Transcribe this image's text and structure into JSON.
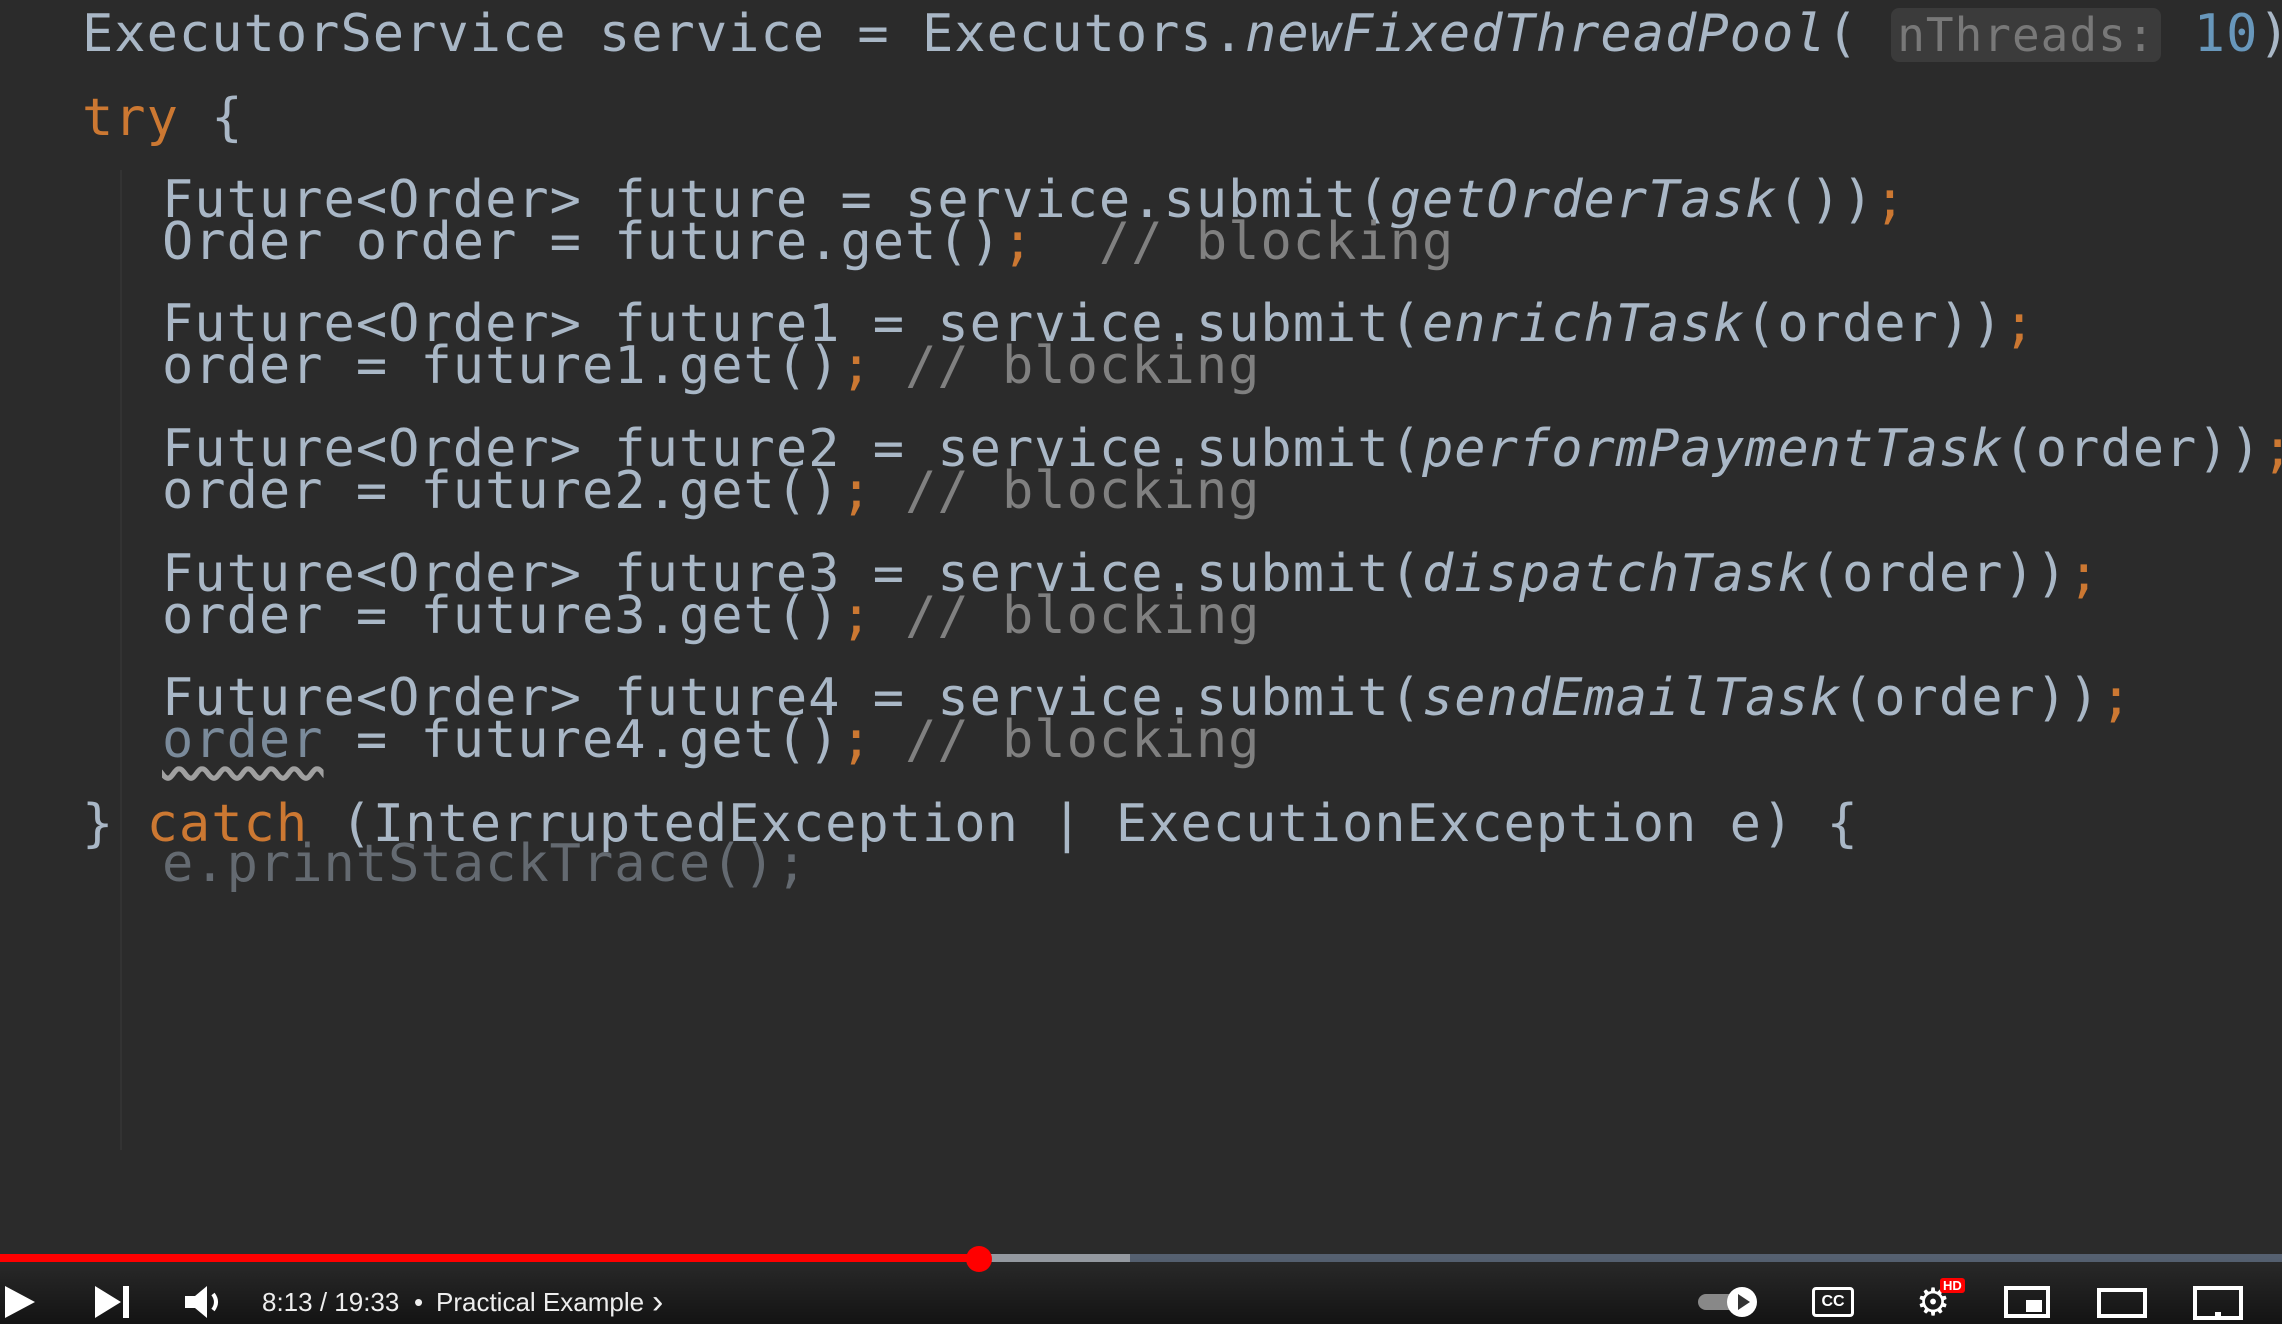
{
  "code": {
    "line1": {
      "a": "ExecutorService service = Executors.",
      "method": "newFixedThreadPool",
      "open": "( ",
      "hint": "nThreads:",
      "num": "10",
      "close": ")",
      "semi": ";"
    },
    "line2": {
      "kw": "try",
      "rest": " {"
    },
    "block1": {
      "l1a": "Future<Order> future = service.submit(",
      "l1m": "getOrderTask",
      "l1b": "())",
      "l1s": ";",
      "l2a": "Order order = future.get()",
      "l2s": ";",
      "l2c": "  // blocking"
    },
    "block2": {
      "l1a": "Future<Order> future1 = service.submit(",
      "l1m": "enrichTask",
      "l1b": "(order))",
      "l1s": ";",
      "l2a": "order = future1.get()",
      "l2s": ";",
      "l2c": " // blocking"
    },
    "block3": {
      "l1a": "Future<Order> future2 = service.submit(",
      "l1m": "performPaymentTask",
      "l1b": "(order))",
      "l1s": ";",
      "l2a": "order = future2.get()",
      "l2s": ";",
      "l2c": " // blocking"
    },
    "block4": {
      "l1a": "Future<Order> future3 = service.submit(",
      "l1m": "dispatchTask",
      "l1b": "(order))",
      "l1s": ";",
      "l2a": "order = future3.get()",
      "l2s": ";",
      "l2c": " // blocking"
    },
    "block5": {
      "l1a": "Future<Order> future4 = service.submit(",
      "l1m": "sendEmailTask",
      "l1b": "(order))",
      "l1s": ";",
      "l2var": "order",
      "l2a": " = future4.get()",
      "l2s": ";",
      "l2c": " // blocking"
    },
    "catch": {
      "a": "} ",
      "kw": "catch",
      "b": " (InterruptedException | ExecutionException e) {"
    },
    "partial": "e.printStackTrace();"
  },
  "player": {
    "time": "8:13 / 19:33",
    "separator": "•",
    "chapter": "Practical Example",
    "chapter_chevron": "›",
    "hd_badge": "HD",
    "cc_label": "CC",
    "progress_played_fraction": 0.429,
    "progress_buffered_fraction": 0.495,
    "accent_color": "#ff0000"
  }
}
